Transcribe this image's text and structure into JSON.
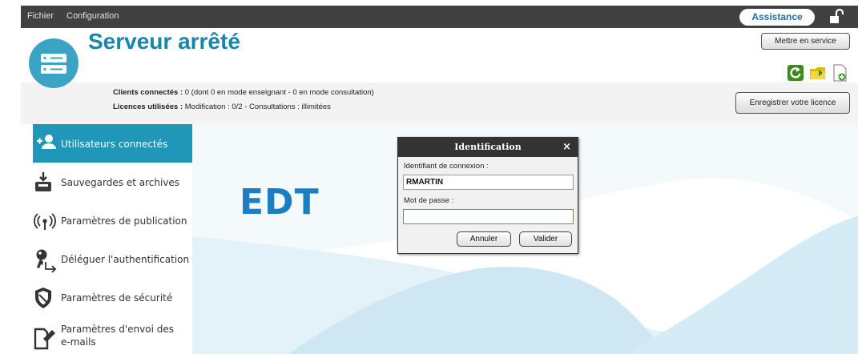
{
  "menubar": {
    "items": [
      "Fichier",
      "Configuration"
    ],
    "assistance_label": "Assistance",
    "lock_icon": "unlock-icon"
  },
  "header": {
    "title": "Serveur arrêté",
    "server_icon": "server-icon",
    "start_button": "Mettre en service",
    "toolbar_icons": [
      "refresh-icon",
      "open-folder-icon",
      "new-document-icon"
    ],
    "clients_label": "Clients connectés :",
    "clients_value": " 0 (dont 0 en mode enseignant - 0 en mode consultation)",
    "licences_label": "Licences utilisées :",
    "licences_value": " Modification : 0/2 - Consultations : illimitées",
    "register_button": "Enregistrer votre licence"
  },
  "sidebar": {
    "items": [
      {
        "label": "Utilisateurs connectés",
        "icon": "connected-users-icon",
        "active": true
      },
      {
        "label": "Sauvegardes et archives",
        "icon": "archive-icon",
        "active": false
      },
      {
        "label": "Paramètres de publication",
        "icon": "broadcast-icon",
        "active": false
      },
      {
        "label": "Déléguer l'authentification",
        "icon": "key-icon",
        "active": false
      },
      {
        "label": "Paramètres de sécurité",
        "icon": "shield-icon",
        "active": false
      },
      {
        "label": "Paramètres d'envoi des",
        "label2": "e-mails",
        "icon": "email-settings-icon",
        "active": false
      }
    ]
  },
  "main": {
    "logo_text": "EDT"
  },
  "dialog": {
    "title": "Identification",
    "close": "×",
    "login_label": "Identifiant de connexion :",
    "login_value": "RMARTIN",
    "password_label": "Mot de passe :",
    "password_value": "",
    "cancel_button": "Annuler",
    "validate_button": "Valider"
  },
  "colors": {
    "accent": "#2096b9",
    "title": "#1985a7",
    "wave": "#dff0f8"
  }
}
